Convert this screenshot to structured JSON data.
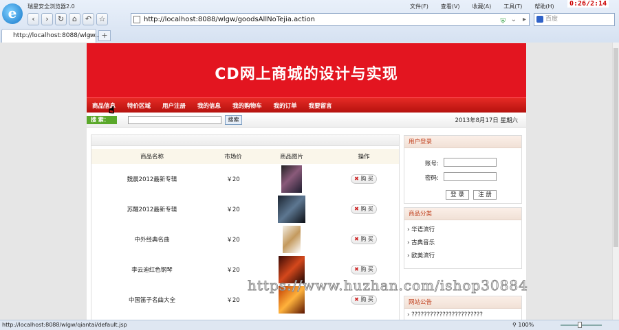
{
  "browser": {
    "title": "瑞星安全浏览器2.0",
    "menu": [
      "文件(F)",
      "查看(V)",
      "收藏(A)",
      "工具(T)",
      "帮助(H)"
    ],
    "clock": "0:26/2:14",
    "url": "http://localhost:8088/wlgw/goodsAllNoTejia.action",
    "search_placeholder": "百度",
    "tab_title": "http://localhost:8088/wlgw...",
    "status_url": "http://localhost:8088/wlgw/qiantai/default.jsp",
    "zoom": "100%"
  },
  "site": {
    "banner_title": "CD网上商城的设计与实现",
    "nav": [
      "商品信息",
      "特价区域",
      "用户注册",
      "我的信息",
      "我的购物车",
      "我的订单",
      "我要留言"
    ],
    "search_label": "搜 索：",
    "search_button": "搜索",
    "date": "2013年8月17日  星期六"
  },
  "products": {
    "headers": [
      "商品名称",
      "市场价",
      "商品图片",
      "操作"
    ],
    "rows": [
      {
        "name": "魏晨2012最新专辑",
        "price": "￥20",
        "buy": "购 买"
      },
      {
        "name": "苏醒2012最新专辑",
        "price": "￥20",
        "buy": "购 买"
      },
      {
        "name": "中外经典名曲",
        "price": "￥20",
        "buy": "购 买"
      },
      {
        "name": "李云迪红色钢琴",
        "price": "￥20",
        "buy": "购 买"
      },
      {
        "name": "中国笛子名曲大全",
        "price": "￥20",
        "buy": "购 买"
      }
    ]
  },
  "login": {
    "title": "用户登录",
    "account_label": "账号:",
    "password_label": "密码:",
    "login_button": "登 录",
    "register_button": "注 册"
  },
  "categories": {
    "title": "商品分类",
    "items": [
      "华语流行",
      "古典音乐",
      "欧美流行"
    ]
  },
  "notice": {
    "title": "网站公告",
    "text": "???????????????????????"
  },
  "watermark": "https://www.huzhan.com/ishop30884"
}
